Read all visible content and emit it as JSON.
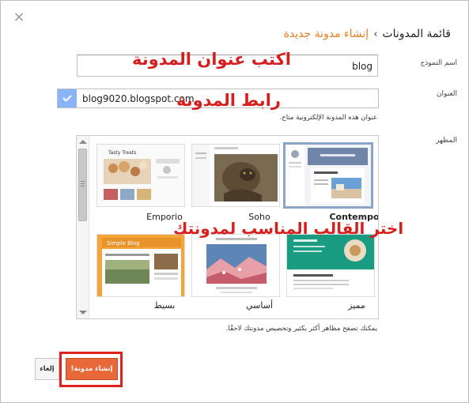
{
  "breadcrumb": {
    "root": "قائمة المدونات",
    "separator": "›",
    "current": "إنشاء مدونة جديدة"
  },
  "close_label": "×",
  "form": {
    "name_label": "اسم النموذج",
    "name_value": "blog",
    "address_label": "العنوان",
    "address_value": "blog9020.blogspot.com",
    "address_hint": "عنوان هذه المدونة الإلكترونية متاح.",
    "theme_label": "المظهر",
    "themes_hint": "يمكنك تصفح مظاهر أكثر بكثير وتخصيص مدونتك لاحقًا."
  },
  "themes": [
    {
      "name": "Contempo",
      "selected": true
    },
    {
      "name": "Soho",
      "selected": false
    },
    {
      "name": "Emporio",
      "selected": false
    },
    {
      "name": "مميز",
      "selected": false
    },
    {
      "name": "أساسي",
      "selected": false
    },
    {
      "name": "بسيط",
      "selected": false
    }
  ],
  "thumb_text": {
    "tasty_treats": "Tasty Treats",
    "simple_blog": "Simple Blog"
  },
  "buttons": {
    "create": "إنشاء مدونة!",
    "cancel": "إلغاء"
  },
  "annotations": {
    "title_hint": "اكتب عنوان المدونة",
    "url_hint": "رابط المدونة",
    "theme_hint": "اختر القالب المناسب لمدونتك"
  },
  "colors": {
    "accent_orange": "#e87c1f",
    "create_button": "#e8683a",
    "annotation_red": "#d62020",
    "selected_border": "#8aa5c8"
  }
}
